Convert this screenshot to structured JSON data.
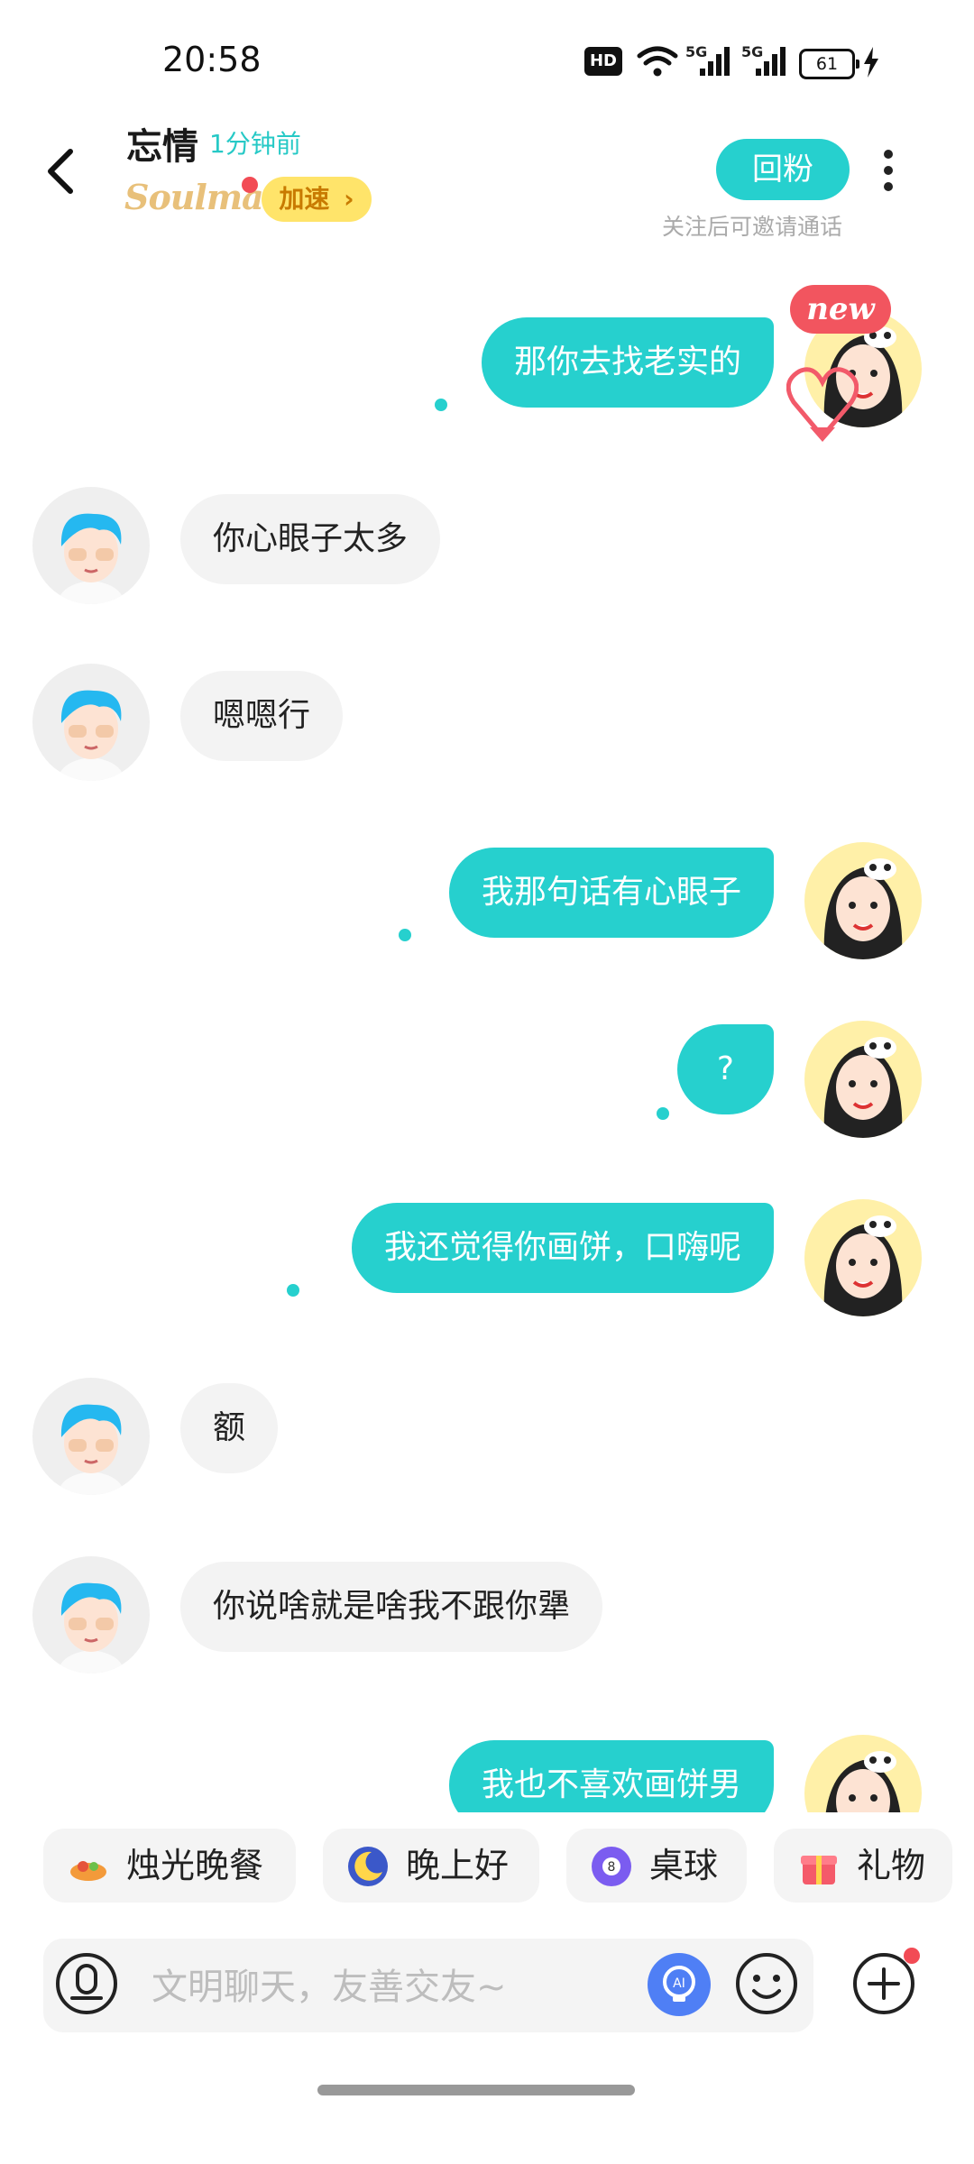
{
  "status_bar": {
    "time": "20:58",
    "battery": "61",
    "hd": "HD",
    "net1": "5G",
    "net2": "5G"
  },
  "header": {
    "contact_name": "忘情",
    "last_active": "1分钟前",
    "soulmate_logo": "Soulmate",
    "speedup_label": "加速",
    "follow_back_label": "回粉",
    "follow_hint": "关注后可邀请通话"
  },
  "new_badge": "new",
  "messages": [
    {
      "side": "out",
      "text": "那你去找老实的"
    },
    {
      "side": "in",
      "text": "你心眼子太多"
    },
    {
      "side": "in",
      "text": "嗯嗯行"
    },
    {
      "side": "out",
      "text": "我那句话有心眼子"
    },
    {
      "side": "out",
      "text": "?"
    },
    {
      "side": "out",
      "text": "我还觉得你画饼，口嗨呢"
    },
    {
      "side": "in",
      "text": "额"
    },
    {
      "side": "in",
      "text": "你说啥就是啥我不跟你犟"
    },
    {
      "side": "out",
      "text": "我也不喜欢画饼男"
    }
  ],
  "quick_chips": [
    {
      "label": "烛光晚餐",
      "icon": "candlelight-dinner-icon"
    },
    {
      "label": "晚上好",
      "icon": "moon-night-icon"
    },
    {
      "label": "桌球",
      "icon": "billiard-ball-icon"
    },
    {
      "label": "礼物",
      "icon": "gift-icon"
    }
  ],
  "input": {
    "placeholder": "文明聊天，友善交友~"
  },
  "colors": {
    "accent": "#26d0ce",
    "incoming_bubble": "#f3f3f3",
    "red_dot": "#f24b55",
    "speedup_bg": "#ffe46a"
  }
}
